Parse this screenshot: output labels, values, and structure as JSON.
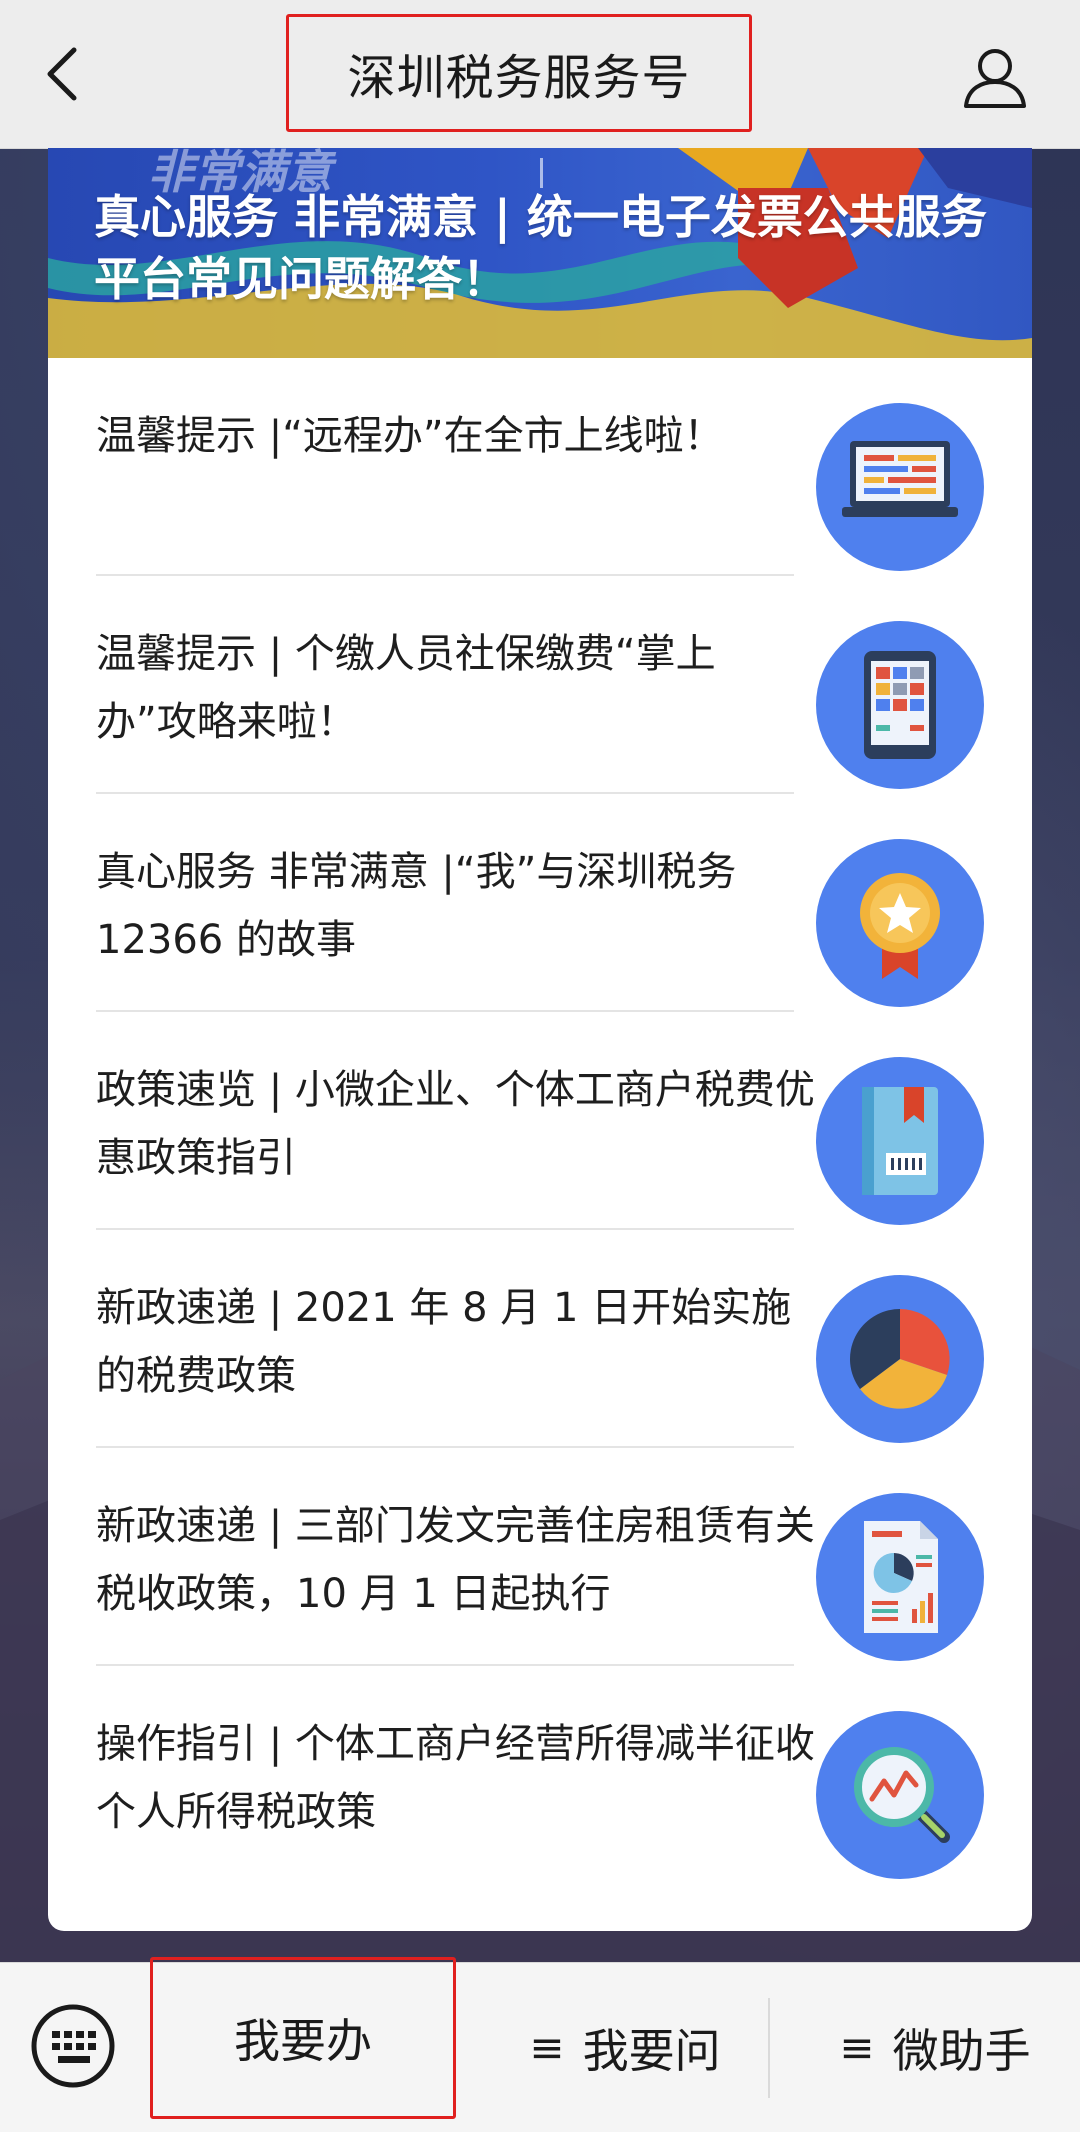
{
  "header": {
    "title": "深圳税务服务号"
  },
  "banner": {
    "faded_text": "非常满意",
    "title": "真心服务 非常满意 | 统一电子发票公共服务平台常见问题解答！"
  },
  "articles": [
    {
      "title": "温馨提示 |“远程办”在全市上线啦！",
      "icon": "laptop-icon"
    },
    {
      "title": "温馨提示 | 个缴人员社保缴费“掌上办”攻略来啦！",
      "icon": "tablet-icon"
    },
    {
      "title": "真心服务 非常满意 |“我”与深圳税务 12366 的故事",
      "icon": "award-medal-icon"
    },
    {
      "title": "政策速览 | 小微企业、个体工商户税费优惠政策指引",
      "icon": "book-icon"
    },
    {
      "title": "新政速递 | 2021 年 8 月 1 日开始实施的税费政策",
      "icon": "pie-chart-icon"
    },
    {
      "title": "新政速递 | 三部门发文完善住房租赁有关税收政策，10 月 1 日起执行",
      "icon": "report-document-icon"
    },
    {
      "title": "操作指引 | 个体工商户经营所得减半征收个人所得税政策",
      "icon": "magnifier-chart-icon"
    }
  ],
  "bottom_menu": {
    "items": [
      {
        "label": "我要办",
        "prefix": ""
      },
      {
        "label": "我要问",
        "prefix": "≡"
      },
      {
        "label": "微助手",
        "prefix": "≡"
      }
    ]
  },
  "colors": {
    "highlight_border": "#e0201f",
    "icon_circle": "#4f80ee",
    "banner_blue": "#2f55c6"
  }
}
